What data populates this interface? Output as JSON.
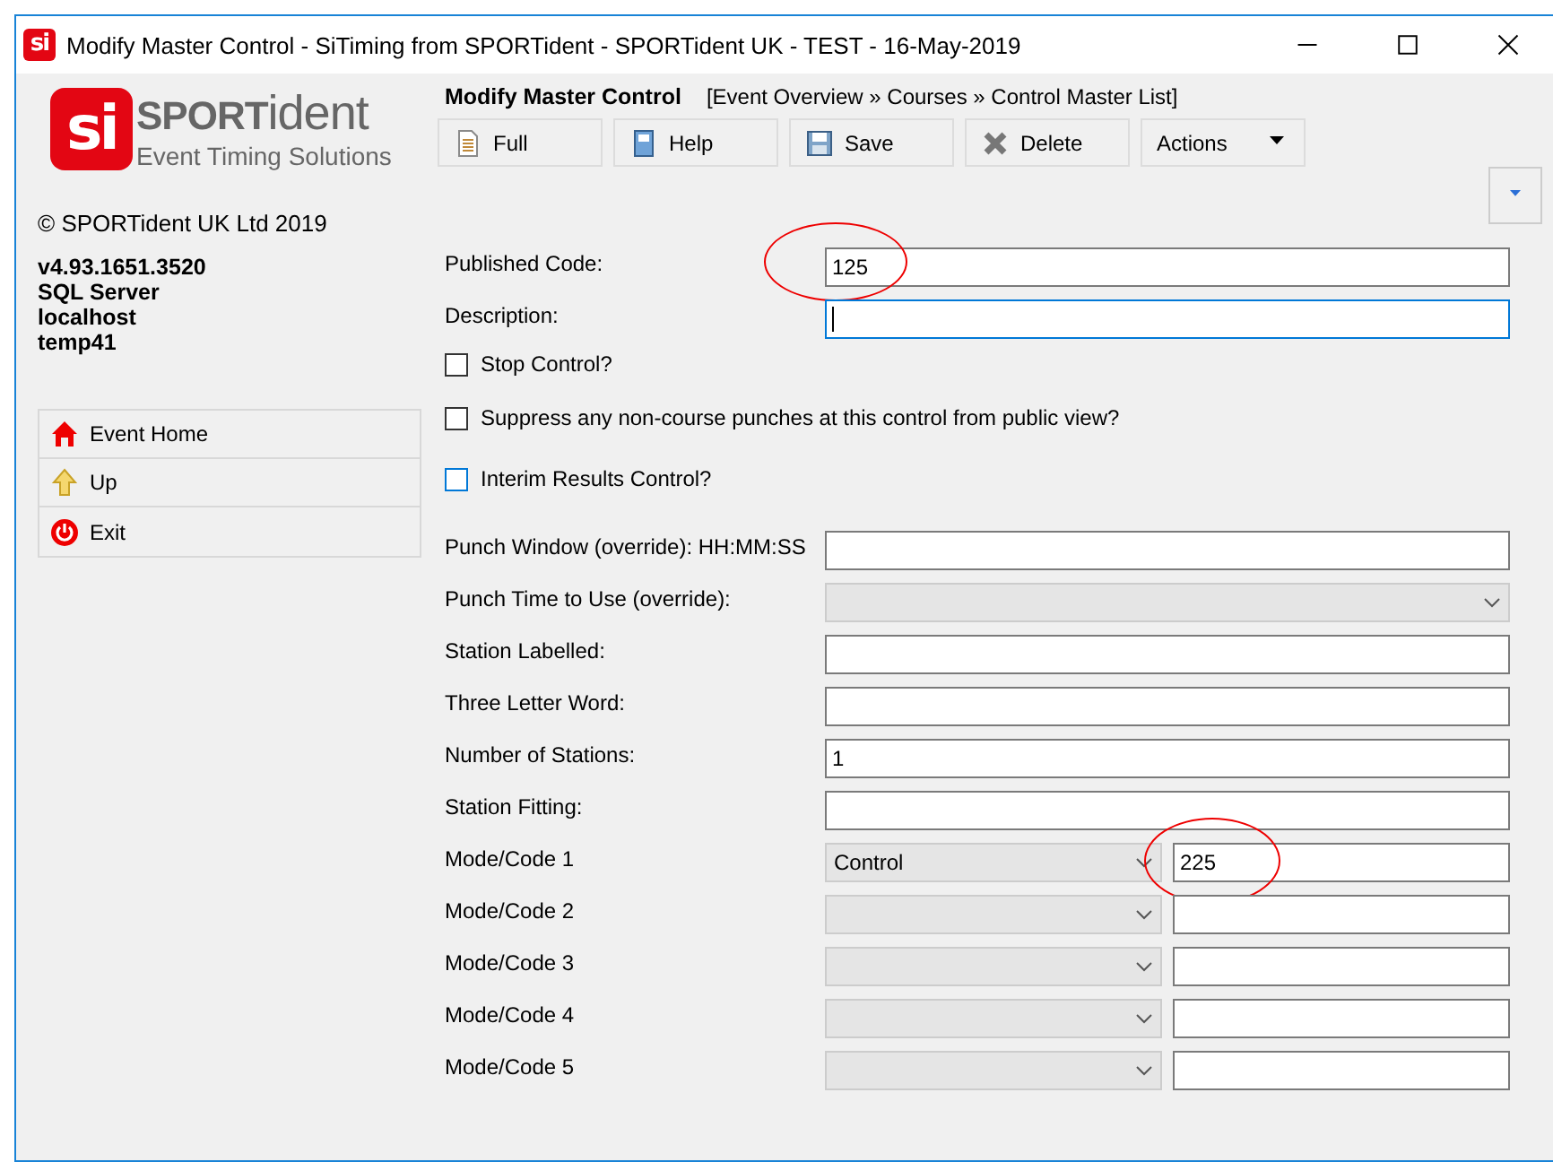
{
  "window": {
    "icon": "si",
    "title": "Modify Master Control - SiTiming from SPORTident - SPORTident UK - TEST - 16-May-2019"
  },
  "sidebar": {
    "logo": {
      "mark": "si",
      "brand": "**SPORT**ident",
      "tagline": "Event Timing Solutions"
    },
    "copyright": "© SPORTident UK Ltd 2019",
    "info": [
      "v4.93.1651.3520",
      "SQL Server",
      "localhost",
      "temp41"
    ],
    "nav": [
      {
        "label": "Event Home"
      },
      {
        "label": "Up"
      },
      {
        "label": "Exit"
      }
    ]
  },
  "header": {
    "title": "Modify Master Control",
    "breadcrumb": "[Event Overview » Courses » Control Master List]"
  },
  "toolbar": [
    {
      "label": "Full"
    },
    {
      "label": "Help"
    },
    {
      "label": "Save"
    },
    {
      "label": "Delete"
    },
    {
      "label": "Actions"
    }
  ],
  "form": [
    {
      "kind": "text",
      "label": "Published Code:",
      "value": "125",
      "focused": false,
      "circled": true
    },
    {
      "kind": "text",
      "label": "Description:",
      "focused": true,
      "circled": false
    },
    {
      "kind": "checkbox",
      "label": "Stop Control?",
      "checked": false,
      "focused": false
    },
    {
      "kind": "checkbox",
      "label": "Suppress any non-course punches at this control from public view?",
      "checked": false,
      "focused": false
    },
    {
      "kind": "checkbox",
      "label": "Interim Results Control?",
      "checked": false,
      "focused": true
    },
    {
      "kind": "text",
      "label": "Punch Window (override): HH:MM:SS",
      "focused": false,
      "circled": false
    },
    {
      "kind": "select",
      "label": "Punch Time to Use (override):"
    },
    {
      "kind": "text",
      "label": "Station Labelled:",
      "focused": false,
      "circled": false
    },
    {
      "kind": "text",
      "label": "Three Letter Word:",
      "focused": false,
      "circled": false
    },
    {
      "kind": "text",
      "label": "Number of Stations:",
      "value": "1",
      "focused": false,
      "circled": false
    },
    {
      "kind": "text",
      "label": "Station Fitting:",
      "focused": false,
      "circled": false
    },
    {
      "kind": "mode",
      "label": "Mode/Code 1",
      "mode": "Control",
      "code": "225",
      "circled": true
    },
    {
      "kind": "mode",
      "label": "Mode/Code 2",
      "circled": false
    },
    {
      "kind": "mode",
      "label": "Mode/Code 3",
      "circled": false
    },
    {
      "kind": "mode",
      "label": "Mode/Code 4",
      "circled": false
    },
    {
      "kind": "mode",
      "label": "Mode/Code 5",
      "circled": false
    }
  ]
}
